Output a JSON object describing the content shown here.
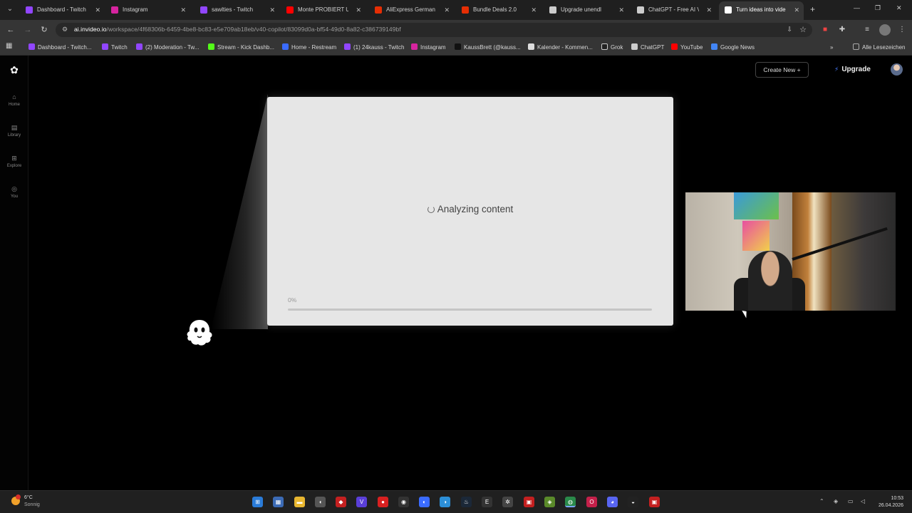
{
  "browser": {
    "tabs": [
      {
        "title": "Dashboard - Twitch",
        "favicon": "twitch-icon",
        "color": "#9146ff"
      },
      {
        "title": "Instagram",
        "favicon": "instagram-icon",
        "color": "#d6249f"
      },
      {
        "title": "sawlties - Twitch",
        "favicon": "twitch-icon",
        "color": "#9146ff"
      },
      {
        "title": "Monte PROBIERT UL",
        "favicon": "youtube-icon",
        "color": "#ff0000"
      },
      {
        "title": "AliExpress German",
        "favicon": "aliexpress-icon",
        "color": "#e62e04"
      },
      {
        "title": "Bundle Deals 2.0",
        "favicon": "aliexpress-icon",
        "color": "#e62e04"
      },
      {
        "title": "Upgrade unendl",
        "favicon": "chatgpt-icon",
        "color": "#cccccc"
      },
      {
        "title": "ChatGPT - Free AI Vi",
        "favicon": "chatgpt-icon",
        "color": "#cccccc"
      },
      {
        "title": "Turn ideas into vide",
        "favicon": "invideo-icon",
        "color": "#ffffff"
      }
    ],
    "url_host": "ai.invideo.io",
    "url_path": "/workspace/4f68306b-6459-4be8-bc83-e5e709ab18eb/v40-copilot/83099d0a-bf54-49d0-8a82-c386739149bf",
    "bookmarks": [
      {
        "label": "Dashboard - Twitch...",
        "color": "#9146ff"
      },
      {
        "label": "Twitch",
        "color": "#9146ff"
      },
      {
        "label": "(2) Moderation - Tw...",
        "color": "#9146ff"
      },
      {
        "label": "Stream - Kick Dashb...",
        "color": "#53fc18"
      },
      {
        "label": "Home - Restream",
        "color": "#3a6bff"
      },
      {
        "label": "(1) 24kauss - Twitch",
        "color": "#9146ff"
      },
      {
        "label": "Instagram",
        "color": "#d6249f"
      },
      {
        "label": "KaussBrett (@kauss...",
        "color": "#111111"
      },
      {
        "label": "Kalender - Kommen...",
        "color": "#dddddd"
      },
      {
        "label": "Grok",
        "color": "#222222"
      },
      {
        "label": "ChatGPT",
        "color": "#cccccc"
      },
      {
        "label": "YouTube",
        "color": "#ff0000"
      },
      {
        "label": "Google News",
        "color": "#4285f4"
      }
    ],
    "all_bookmarks": "Alle Lesezeichen"
  },
  "app": {
    "sidebar": [
      {
        "label": "Home",
        "icon": "home-icon"
      },
      {
        "label": "Library",
        "icon": "library-icon"
      },
      {
        "label": "Explore",
        "icon": "explore-icon"
      },
      {
        "label": "You",
        "icon": "user-icon"
      }
    ],
    "create_new": "Create New",
    "upgrade": "Upgrade",
    "status_text": "Analyzing content",
    "progress_label": "0%",
    "progress_value": 0
  },
  "taskbar": {
    "temperature": "6°C",
    "weather": "Sonnig",
    "time": "10:53",
    "date": "26.04.2026"
  }
}
